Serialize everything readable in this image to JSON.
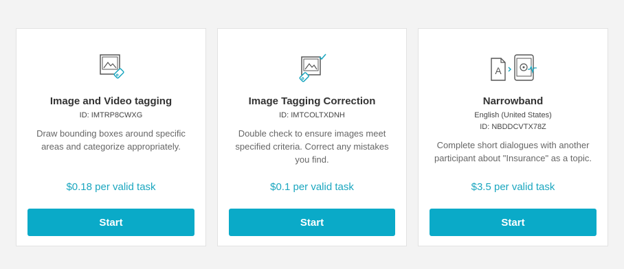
{
  "accent_color": "#0aaac8",
  "price_color": "#1aa6bf",
  "cards": [
    {
      "icon": "image-tag-icon",
      "title": "Image and Video tagging",
      "id": "ID: IMTRP8CWXG",
      "description": "Draw bounding boxes around specific areas and categorize appropriately.",
      "price": "$0.18 per valid task",
      "button_label": "Start"
    },
    {
      "icon": "image-tag-check-icon",
      "title": "Image Tagging Correction",
      "id": "ID: IMTCOLTXDNH",
      "description": "Double check to ensure images meet specified criteria. Correct any mistakes you find.",
      "price": "$0.1 per valid task",
      "button_label": "Start"
    },
    {
      "icon": "document-to-phone-icon",
      "title": "Narrowband",
      "language": "English (United States)",
      "id": "ID: NBDDCVTX78Z",
      "description": "Complete short dialogues with another participant about \"Insurance\" as a topic.",
      "price": "$3.5 per valid task",
      "button_label": "Start"
    }
  ]
}
